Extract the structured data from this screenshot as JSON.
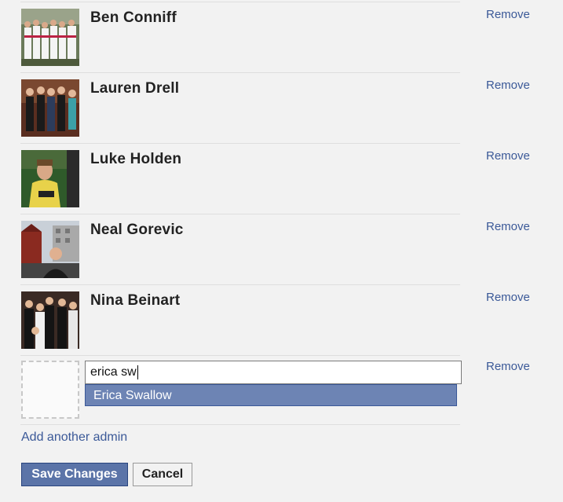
{
  "admins": [
    {
      "name": "Ben Conniff",
      "remove_label": "Remove"
    },
    {
      "name": "Lauren Drell",
      "remove_label": "Remove"
    },
    {
      "name": "Luke Holden",
      "remove_label": "Remove"
    },
    {
      "name": "Neal Gorevic",
      "remove_label": "Remove"
    },
    {
      "name": "Nina Beinart",
      "remove_label": "Remove"
    }
  ],
  "new_admin": {
    "input_value": "erica sw",
    "suggestion": "Erica Swallow",
    "remove_label": "Remove"
  },
  "add_another_label": "Add another admin",
  "save_label": "Save Changes",
  "cancel_label": "Cancel",
  "colors": {
    "link": "#3b5998",
    "suggest_bg": "#6d84b4",
    "save_bg": "#5b74a8"
  }
}
